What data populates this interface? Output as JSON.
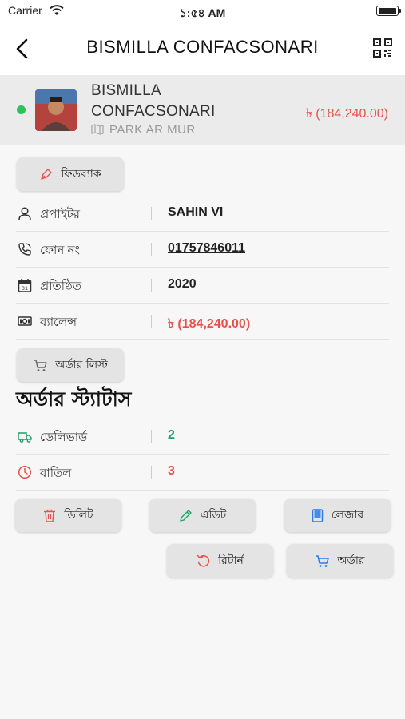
{
  "status_bar": {
    "carrier": "Carrier",
    "time": "১:৫৪ AM"
  },
  "nav": {
    "title": "BISMILLA CONFACSONARI"
  },
  "header": {
    "name": "BISMILLA CONFACSONARI",
    "location": "PARK AR MUR",
    "balance": "৳ (184,240.00)",
    "online_color": "#2ec05a"
  },
  "feedback_button": {
    "label": "ফিডব্যাক"
  },
  "details": [
    {
      "label": "প্রপাইটর",
      "value": "SAHIN VI",
      "icon": "user-icon"
    },
    {
      "label": "ফোন নং",
      "value": "01757846011",
      "icon": "phone-icon"
    },
    {
      "label": "প্রতিষ্ঠিত",
      "value": "2020",
      "icon": "calendar-icon"
    },
    {
      "label": "ব্যালেন্স",
      "value": "৳ (184,240.00)",
      "icon": "cash-icon"
    }
  ],
  "order_list_button": {
    "label": "অর্ডার লিস্ট"
  },
  "order_status": {
    "title": "অর্ডার স্ট্যাটাস",
    "rows": [
      {
        "label": "ডেলিভার্ড",
        "value": "2",
        "icon": "truck-icon",
        "color": "#1aa36a"
      },
      {
        "label": "বাতিল",
        "value": "3",
        "icon": "clock-icon",
        "color": "#e5534b"
      }
    ]
  },
  "actions": {
    "delete": "ডিলিট",
    "edit": "এডিট",
    "ledger": "লেজার",
    "return": "রিটার্ন",
    "order": "অর্ডার"
  },
  "colors": {
    "accent_red": "#e5534b",
    "accent_green": "#1aa36a",
    "accent_blue": "#2b7de9"
  }
}
